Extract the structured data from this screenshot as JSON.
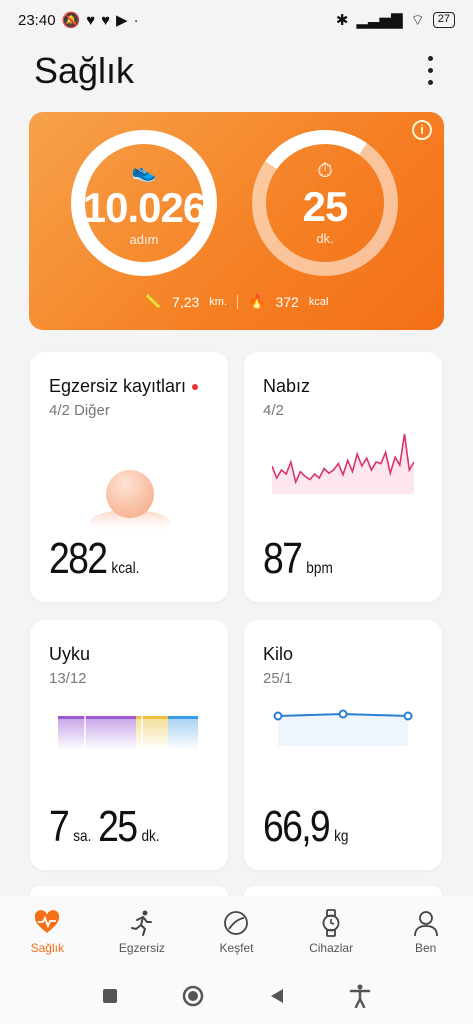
{
  "status_bar": {
    "time": "23:40",
    "dot": "·",
    "battery": "27"
  },
  "app": {
    "title": "Sağlık"
  },
  "activity": {
    "steps_value": "10.026",
    "steps_unit": "adım",
    "minutes_value": "25",
    "minutes_unit": "dk.",
    "distance_value": "7,23",
    "distance_unit": "km.",
    "calories_value": "372",
    "calories_unit": "kcal"
  },
  "cards": {
    "exercise": {
      "title": "Egzersiz kayıtları",
      "subtitle": "4/2 Diğer",
      "value": "282",
      "unit": "kcal."
    },
    "heart": {
      "title": "Nabız",
      "subtitle": "4/2",
      "value": "87",
      "unit": "bpm",
      "series": [
        55,
        40,
        50,
        45,
        60,
        35,
        48,
        42,
        38,
        45,
        40,
        52,
        46,
        50,
        58,
        44,
        62,
        48,
        70,
        55,
        65,
        50,
        60,
        58,
        72,
        46,
        66,
        56,
        95,
        50,
        60
      ],
      "color": "#d8336b"
    },
    "sleep": {
      "title": "Uyku",
      "subtitle": "13/12",
      "hours": "7",
      "hours_unit": "sa.",
      "minutes": "25",
      "minutes_unit": "dk."
    },
    "weight": {
      "title": "Kilo",
      "subtitle": "25/1",
      "value": "66,9",
      "unit": "kg",
      "points": [
        66.9,
        67.0,
        66.9
      ],
      "color": "#2c7fd0"
    }
  },
  "bottom_nav": [
    {
      "label": "Sağlık",
      "icon": "heart-icon",
      "active": true
    },
    {
      "label": "Egzersiz",
      "icon": "runner-icon",
      "active": false
    },
    {
      "label": "Keşfet",
      "icon": "compass-icon",
      "active": false
    },
    {
      "label": "Cihazlar",
      "icon": "watch-icon",
      "active": false
    },
    {
      "label": "Ben",
      "icon": "user-icon",
      "active": false
    }
  ],
  "colors": {
    "accent": "#f46f17",
    "hero_start": "#f7a24a",
    "hero_end": "#f46f17"
  }
}
